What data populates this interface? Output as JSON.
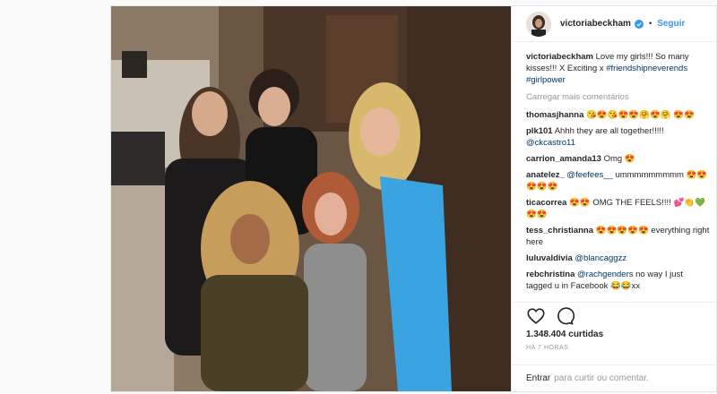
{
  "post": {
    "author": "victoriabeckham",
    "follow_label": "Seguir",
    "caption": {
      "user": "victoriabeckham",
      "text": "Love my girls!!! So many kisses!!! X Exciting x",
      "hashtags": "#friendshipneverends #girlpower"
    },
    "load_more": "Carregar mais comentários",
    "comments": [
      {
        "user": "thomasjhanna",
        "text": "😘😍😘😍😍🤗😍🤗 😍😍"
      },
      {
        "user": "plk101",
        "text": "Ahhh they are all together!!!!!",
        "mention": "@ckcastro11"
      },
      {
        "user": "carrion_amanda13",
        "text": "Omg 😍"
      },
      {
        "user": "anatelez_",
        "mention": "@feefees__",
        "text": "ummmmmmmmm 😍😍😍😍😍"
      },
      {
        "user": "ticacorrea",
        "text": "😍😍 OMG THE FEELS!!!! 💕👏💚 😍😍"
      },
      {
        "user": "tess_christianna",
        "text": "😍😍😍😍😍 everything right here"
      },
      {
        "user": "luluvaldivia",
        "mention": "@blancaggzz",
        "text": ""
      },
      {
        "user": "rebchristina",
        "mention": "@rachgenders",
        "text": "no way I just tagged u in Facebook 😂😂xx"
      }
    ],
    "likes": "1.348.404 curtidas",
    "time": "HÁ 7 HORAS",
    "add_comment": {
      "enter": "Entrar",
      "rest": "para curtir ou comentar."
    }
  }
}
